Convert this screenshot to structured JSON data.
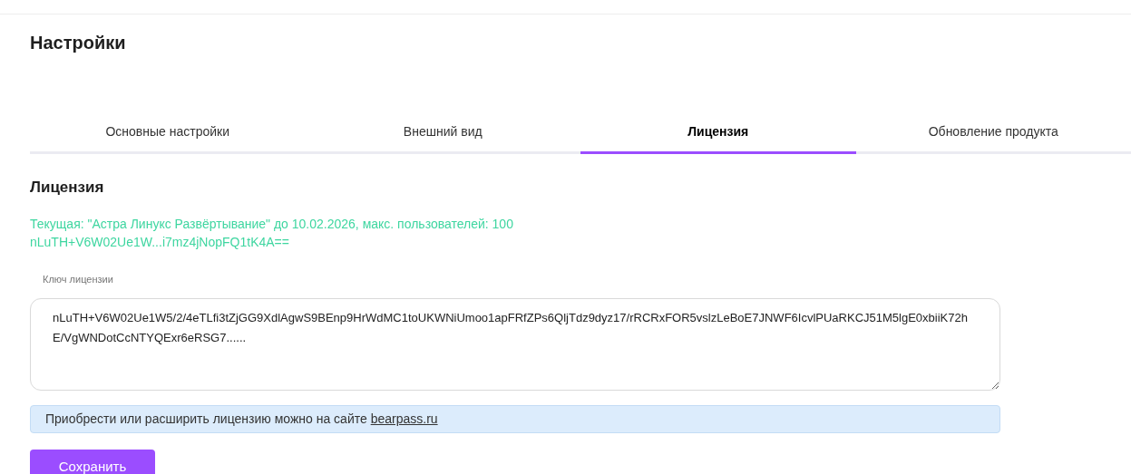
{
  "title": "Настройки",
  "tabs": [
    {
      "label": "Основные настройки",
      "selected": false
    },
    {
      "label": "Внешний вид",
      "selected": false
    },
    {
      "label": "Лицензия",
      "selected": true
    },
    {
      "label": "Обновление продукта",
      "selected": false
    }
  ],
  "section_title": "Лицензия",
  "current_license": [
    "Текущая: \"Астра Линукс Развёртывание\" до 10.02.2026, макс. пользователей: 100",
    "nLuTH+V6W02Ue1W...i7mz4jNopFQ1tK4A=="
  ],
  "key_field": {
    "label": "Ключ лицензии",
    "value": "nLuTH+V6W02Ue1W5/2/4eTLfi3tZjGG9XdlAgwS9BEnp9HrWdMC1toUKWNiUmoo1apFRfZPs6QljTdz9dyz17/rRCRxFOR5vslzLeBoE7JNWF6IcvlPUaRKCJ51M5lgE0xbiiK72hE/VgWNDotCcNTYQExr6eRSG7......"
  },
  "info": {
    "text": "Приобрести или расширить лицензию можно на сайте",
    "link": "bearpass.ru"
  },
  "save_button": "Сохранить"
}
